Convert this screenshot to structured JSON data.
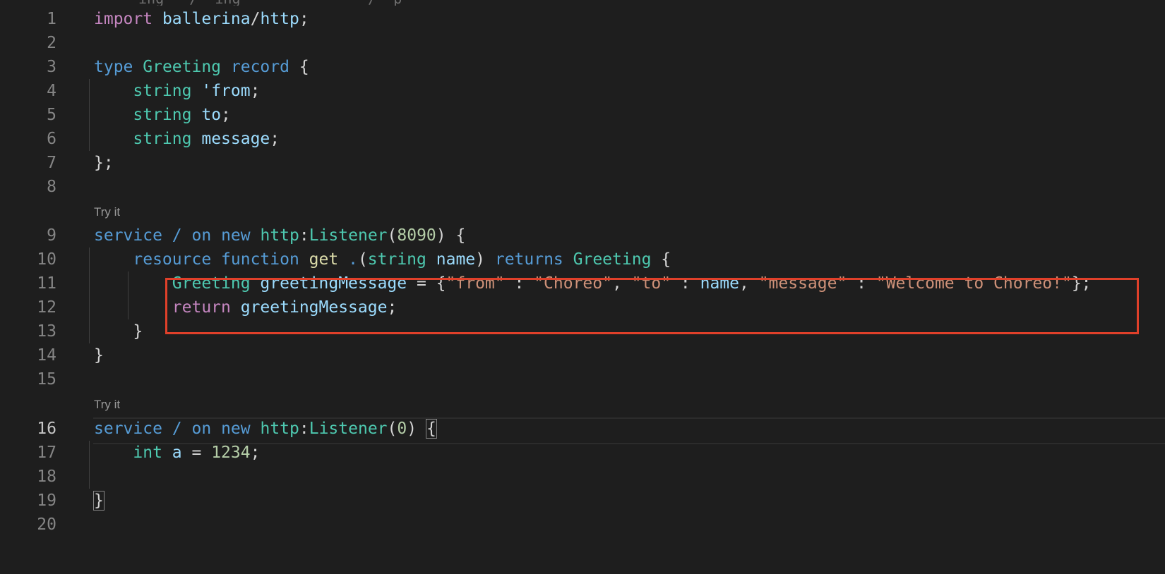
{
  "editor": {
    "top_partial_text": "ing_  /  ing_              /  p  ",
    "codelens": {
      "service1": "Try it",
      "service2": "Try it"
    },
    "line_numbers": [
      "1",
      "2",
      "3",
      "4",
      "5",
      "6",
      "7",
      "8",
      "9",
      "10",
      "11",
      "12",
      "13",
      "14",
      "15",
      "16",
      "17",
      "18",
      "19",
      "20"
    ],
    "lines": {
      "l1": [
        [
          "ctl",
          "import"
        ],
        [
          "pun",
          " "
        ],
        [
          "var",
          "ballerina"
        ],
        [
          "pun",
          "/"
        ],
        [
          "var",
          "http"
        ],
        [
          "pun",
          ";"
        ]
      ],
      "l3": [
        [
          "kw",
          "type"
        ],
        [
          "pun",
          " "
        ],
        [
          "ty",
          "Greeting"
        ],
        [
          "pun",
          " "
        ],
        [
          "kw",
          "record"
        ],
        [
          "pun",
          " {"
        ]
      ],
      "l4": [
        [
          "pun",
          "    "
        ],
        [
          "ty",
          "string"
        ],
        [
          "pun",
          " "
        ],
        [
          "var",
          "'from"
        ],
        [
          "pun",
          ";"
        ]
      ],
      "l5": [
        [
          "pun",
          "    "
        ],
        [
          "ty",
          "string"
        ],
        [
          "pun",
          " "
        ],
        [
          "var",
          "to"
        ],
        [
          "pun",
          ";"
        ]
      ],
      "l6": [
        [
          "pun",
          "    "
        ],
        [
          "ty",
          "string"
        ],
        [
          "pun",
          " "
        ],
        [
          "var",
          "message"
        ],
        [
          "pun",
          ";"
        ]
      ],
      "l7": [
        [
          "pun",
          "};"
        ]
      ],
      "l9": [
        [
          "kw",
          "service"
        ],
        [
          "pun",
          " "
        ],
        [
          "kw",
          "/"
        ],
        [
          "pun",
          " "
        ],
        [
          "kw",
          "on"
        ],
        [
          "pun",
          " "
        ],
        [
          "kw",
          "new"
        ],
        [
          "pun",
          " "
        ],
        [
          "ty",
          "http"
        ],
        [
          "pun",
          ":"
        ],
        [
          "ty",
          "Listener"
        ],
        [
          "pun",
          "("
        ],
        [
          "num",
          "8090"
        ],
        [
          "pun",
          ") {"
        ]
      ],
      "l10": [
        [
          "pun",
          "    "
        ],
        [
          "kw",
          "resource"
        ],
        [
          "pun",
          " "
        ],
        [
          "kw",
          "function"
        ],
        [
          "pun",
          " "
        ],
        [
          "fn",
          "get"
        ],
        [
          "pun",
          " "
        ],
        [
          "kw",
          "."
        ],
        [
          "pun",
          "("
        ],
        [
          "ty",
          "string"
        ],
        [
          "pun",
          " "
        ],
        [
          "var",
          "name"
        ],
        [
          "pun",
          ") "
        ],
        [
          "kw",
          "returns"
        ],
        [
          "pun",
          " "
        ],
        [
          "ty",
          "Greeting"
        ],
        [
          "pun",
          " {"
        ]
      ],
      "l11": [
        [
          "pun",
          "        "
        ],
        [
          "ty",
          "Greeting"
        ],
        [
          "pun",
          " "
        ],
        [
          "var",
          "greetingMessage"
        ],
        [
          "pun",
          " = {"
        ],
        [
          "str",
          "\"from\""
        ],
        [
          "pun",
          " : "
        ],
        [
          "str",
          "\"Choreo\""
        ],
        [
          "pun",
          ", "
        ],
        [
          "str",
          "\"to\""
        ],
        [
          "pun",
          " : "
        ],
        [
          "var",
          "name"
        ],
        [
          "pun",
          ", "
        ],
        [
          "str",
          "\"message\""
        ],
        [
          "pun",
          " : "
        ],
        [
          "str",
          "\"Welcome to Choreo!\""
        ],
        [
          "pun",
          "};"
        ]
      ],
      "l12": [
        [
          "pun",
          "        "
        ],
        [
          "ctl",
          "return"
        ],
        [
          "pun",
          " "
        ],
        [
          "var",
          "greetingMessage"
        ],
        [
          "pun",
          ";"
        ]
      ],
      "l13": [
        [
          "pun",
          "    }"
        ]
      ],
      "l14": [
        [
          "pun",
          "}"
        ]
      ],
      "l16": [
        [
          "kw",
          "service"
        ],
        [
          "pun",
          " "
        ],
        [
          "kw",
          "/"
        ],
        [
          "pun",
          " "
        ],
        [
          "kw",
          "on"
        ],
        [
          "pun",
          " "
        ],
        [
          "kw",
          "new"
        ],
        [
          "pun",
          " "
        ],
        [
          "ty",
          "http"
        ],
        [
          "pun",
          ":"
        ],
        [
          "ty",
          "Listener"
        ],
        [
          "pun",
          "("
        ],
        [
          "num",
          "0"
        ],
        [
          "pun",
          ") "
        ],
        [
          "box",
          "{"
        ]
      ],
      "l17": [
        [
          "pun",
          "    "
        ],
        [
          "ty",
          "int"
        ],
        [
          "pun",
          " "
        ],
        [
          "var",
          "a"
        ],
        [
          "pun",
          " = "
        ],
        [
          "num",
          "1234"
        ],
        [
          "pun",
          ";"
        ]
      ],
      "l19": [
        [
          "box",
          "}"
        ]
      ]
    }
  },
  "colors": {
    "background": "#1e1e1e",
    "highlight_border": "#e0402a",
    "keyword": "#569cd6",
    "control": "#c586c0",
    "type": "#4ec9b0",
    "variable": "#9cdcfe",
    "string": "#ce9178",
    "number": "#b5cea8",
    "function": "#dcdcaa"
  }
}
